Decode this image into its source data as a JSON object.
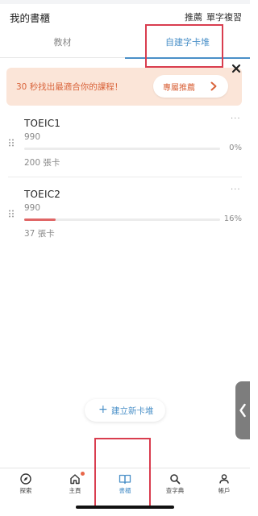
{
  "header": {
    "title": "我的書櫃",
    "recommend": "推薦",
    "word_review": "單字複習"
  },
  "tabs": [
    {
      "label": "教材"
    },
    {
      "label": "自建字卡堆"
    }
  ],
  "banner": {
    "text": "30 秒找出最適合你的課程！",
    "button": "專屬推薦"
  },
  "decks": [
    {
      "name": "TOEIC1",
      "count": "990",
      "progress": 0,
      "percent": "0%",
      "cards": "200 張卡"
    },
    {
      "name": "TOEIC2",
      "count": "990",
      "progress": 16,
      "percent": "16%",
      "cards": "37 張卡"
    }
  ],
  "create_button": {
    "label": "建立新卡堆"
  },
  "nav": [
    {
      "label": "探索",
      "icon": "compass-icon"
    },
    {
      "label": "主頁",
      "icon": "home-icon"
    },
    {
      "label": "書櫃",
      "icon": "book-icon"
    },
    {
      "label": "查字典",
      "icon": "search-icon"
    },
    {
      "label": "帳戶",
      "icon": "user-icon"
    }
  ],
  "colors": {
    "accent": "#4a90c8",
    "banner_bg": "#fbe5d8",
    "banner_text": "#d9633a",
    "progress_fill": "#e06666",
    "highlight": "#d93d4f"
  }
}
